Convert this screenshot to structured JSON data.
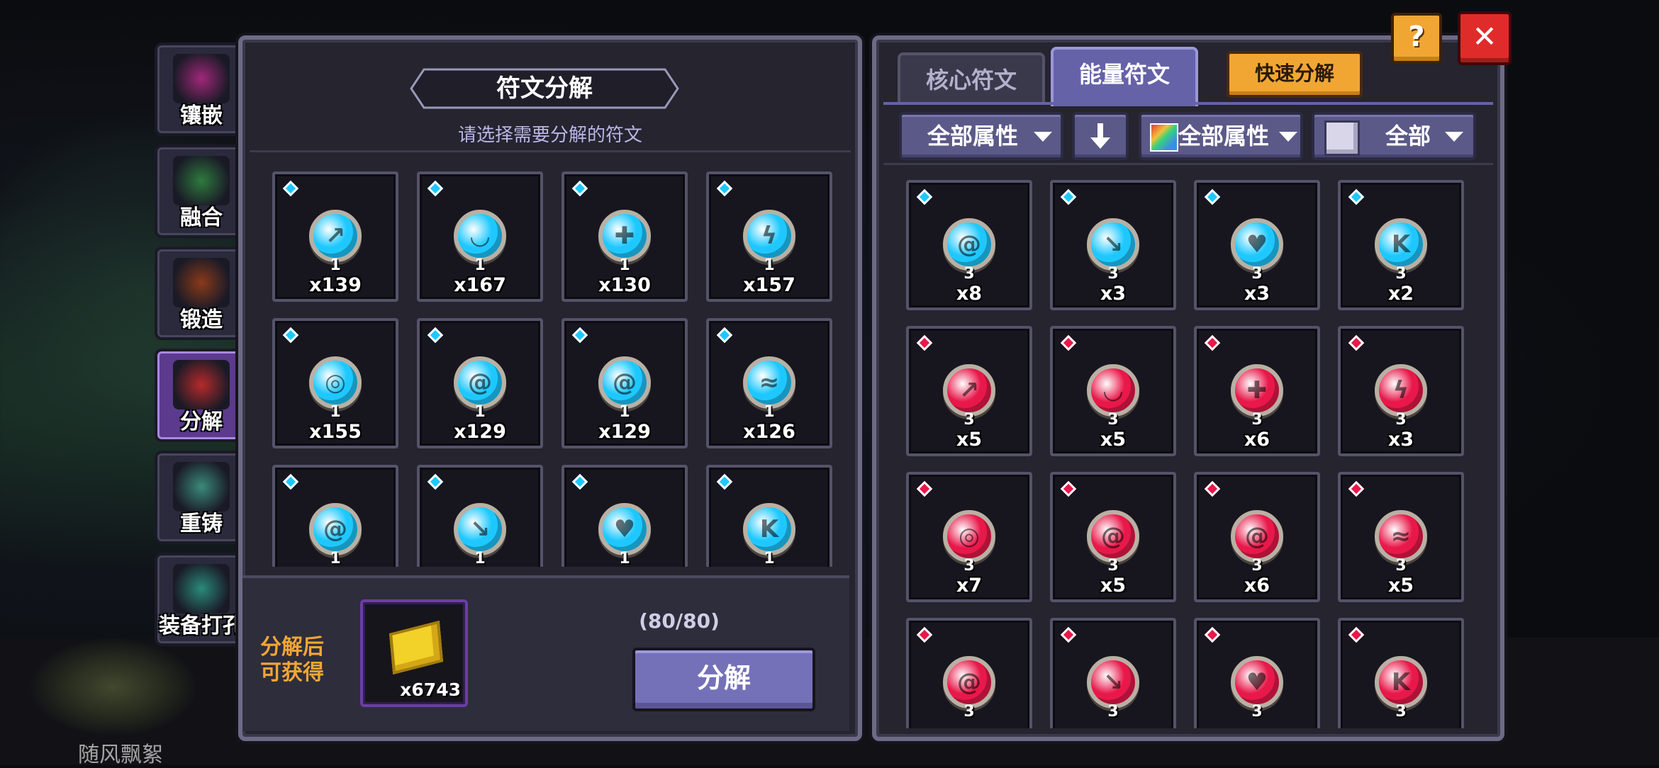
{
  "colors": {
    "blue_rune": "#1ec8ff",
    "red_rune": "#e8184a",
    "accent_orange": "#f1a634",
    "panel_bg": "#25242f",
    "panel_border": "#6d6a86",
    "active_tab": "#5c3a8e"
  },
  "side_tabs": [
    {
      "label": "镶嵌",
      "icon": "inlay-icon"
    },
    {
      "label": "融合",
      "icon": "fusion-icon"
    },
    {
      "label": "锻造",
      "icon": "anvil-icon"
    },
    {
      "label": "分解",
      "icon": "decompose-icon",
      "active": true
    },
    {
      "label": "重铸",
      "icon": "crystals-icon"
    },
    {
      "label": "装备打孔",
      "icon": "drill-icon"
    }
  ],
  "background_text": "随风飘絮",
  "left_panel": {
    "title": "符文分解",
    "subtitle": "请选择需要分解的符文",
    "slots": [
      {
        "level": "1",
        "count": "x139",
        "glyph": "↗"
      },
      {
        "level": "1",
        "count": "x167",
        "glyph": "◡"
      },
      {
        "level": "1",
        "count": "x130",
        "glyph": "✚"
      },
      {
        "level": "1",
        "count": "x157",
        "glyph": "ϟ"
      },
      {
        "level": "1",
        "count": "x155",
        "glyph": "◎"
      },
      {
        "level": "1",
        "count": "x129",
        "glyph": "@"
      },
      {
        "level": "1",
        "count": "x129",
        "glyph": "@"
      },
      {
        "level": "1",
        "count": "x126",
        "glyph": "≈"
      },
      {
        "level": "1",
        "count": "",
        "glyph": "@"
      },
      {
        "level": "1",
        "count": "",
        "glyph": "↘"
      },
      {
        "level": "1",
        "count": "",
        "glyph": "♥"
      },
      {
        "level": "1",
        "count": "",
        "glyph": "K"
      }
    ],
    "reward_label": "分解后\n可获得",
    "reward_count": "x6743",
    "capacity": "(80/80)",
    "decompose_button": "分解"
  },
  "right_panel": {
    "tabs": [
      {
        "label": "核心符文",
        "active": false
      },
      {
        "label": "能量符文",
        "active": true
      }
    ],
    "quick_decompose": "快速分解",
    "filters": {
      "attribute1": "全部属性",
      "sort_icon": "arrow-down-icon",
      "attribute2": "全部属性",
      "category": "全部"
    },
    "slots": [
      {
        "level": "3",
        "count": "x8",
        "color": "blue",
        "glyph": "@"
      },
      {
        "level": "3",
        "count": "x3",
        "color": "blue",
        "glyph": "↘"
      },
      {
        "level": "3",
        "count": "x3",
        "color": "blue",
        "glyph": "♥"
      },
      {
        "level": "3",
        "count": "x2",
        "color": "blue",
        "glyph": "K"
      },
      {
        "level": "3",
        "count": "x5",
        "color": "red",
        "glyph": "↗"
      },
      {
        "level": "3",
        "count": "x5",
        "color": "red",
        "glyph": "◡"
      },
      {
        "level": "3",
        "count": "x6",
        "color": "red",
        "glyph": "✚"
      },
      {
        "level": "3",
        "count": "x3",
        "color": "red",
        "glyph": "ϟ"
      },
      {
        "level": "3",
        "count": "x7",
        "color": "red",
        "glyph": "◎"
      },
      {
        "level": "3",
        "count": "x5",
        "color": "red",
        "glyph": "@"
      },
      {
        "level": "3",
        "count": "x6",
        "color": "red",
        "glyph": "@"
      },
      {
        "level": "3",
        "count": "x5",
        "color": "red",
        "glyph": "≈"
      },
      {
        "level": "3",
        "count": "",
        "color": "red",
        "glyph": "@"
      },
      {
        "level": "3",
        "count": "",
        "color": "red",
        "glyph": "↘"
      },
      {
        "level": "3",
        "count": "",
        "color": "red",
        "glyph": "♥"
      },
      {
        "level": "3",
        "count": "",
        "color": "red",
        "glyph": "K"
      }
    ]
  },
  "top_buttons": {
    "help": "?",
    "close": "✕"
  }
}
